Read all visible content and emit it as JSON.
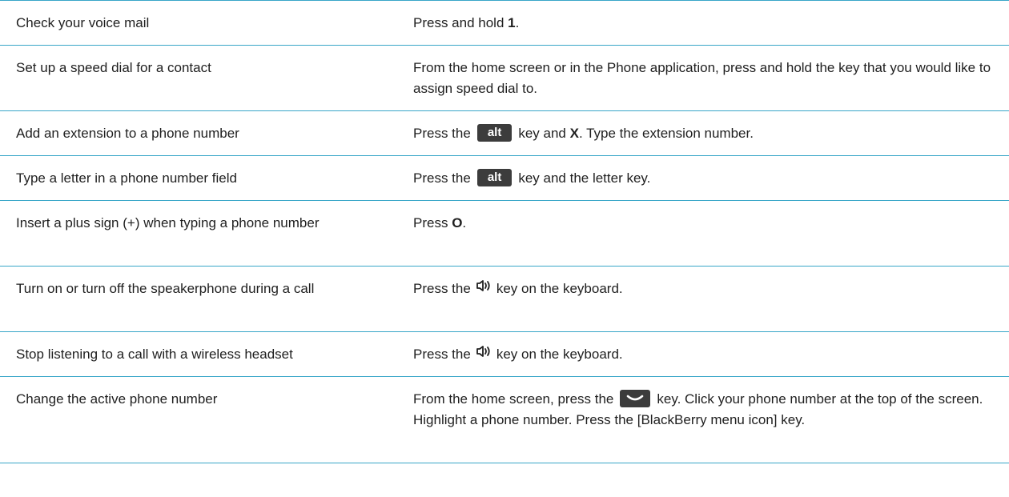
{
  "rows": [
    {
      "action": "Check your voice mail",
      "parts": {
        "a": "Press and hold ",
        "b": "1",
        "c": "."
      }
    },
    {
      "action": "Set up a speed dial for a contact",
      "text": "From the home screen or in the Phone application, press and hold the key that you would like to assign speed dial to."
    },
    {
      "action": "Add an extension to a phone number",
      "parts": {
        "a": "Press the",
        "key": "alt",
        "b": "key and ",
        "c": "X",
        "d": ". Type the extension number."
      }
    },
    {
      "action": "Type a letter in a phone number field",
      "parts": {
        "a": "Press the",
        "key": "alt",
        "b": "key and the letter key."
      }
    },
    {
      "action": "Insert a plus sign (+) when typing a phone number",
      "parts": {
        "a": "Press ",
        "b": "O",
        "c": "."
      }
    },
    {
      "action": "Turn on or turn off the speakerphone during a call",
      "parts": {
        "a": "Press the",
        "icon": "speaker-icon",
        "b": "key on the keyboard."
      }
    },
    {
      "action": "Stop listening to a call with a wireless headset",
      "parts": {
        "a": "Press the",
        "icon": "speaker-icon",
        "b": "key on the keyboard."
      }
    },
    {
      "action": "Change the active phone number",
      "parts": {
        "a": "From the home screen, press the",
        "icon": "send-key-icon",
        "b": "key. Click your phone number at the top of the screen. Highlight a phone number. Press the [BlackBerry menu icon] key."
      }
    }
  ],
  "colors": {
    "rule": "#38a6c8",
    "key_bg": "#3c3c3c"
  }
}
